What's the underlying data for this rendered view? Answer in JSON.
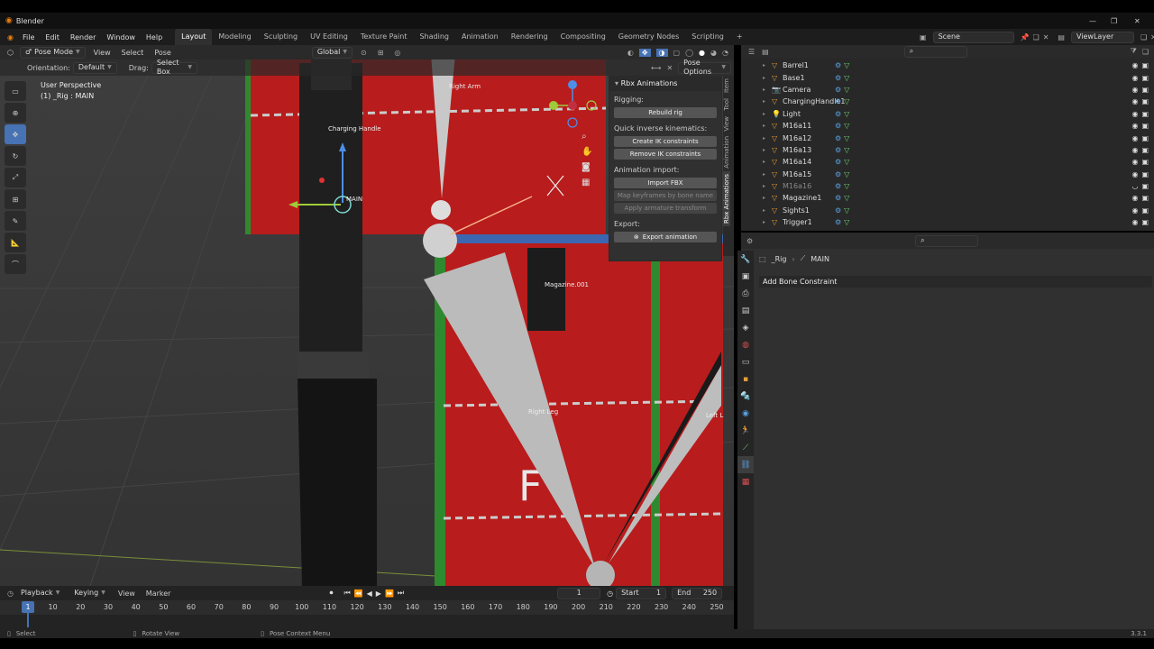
{
  "app": {
    "title": "Blender",
    "version": "3.3.1"
  },
  "menu": [
    "File",
    "Edit",
    "Render",
    "Window",
    "Help"
  ],
  "workspaces": [
    {
      "label": "Layout",
      "active": true
    },
    {
      "label": "Modeling"
    },
    {
      "label": "Sculpting"
    },
    {
      "label": "UV Editing"
    },
    {
      "label": "Texture Paint"
    },
    {
      "label": "Shading"
    },
    {
      "label": "Animation"
    },
    {
      "label": "Rendering"
    },
    {
      "label": "Compositing"
    },
    {
      "label": "Geometry Nodes"
    },
    {
      "label": "Scripting"
    }
  ],
  "add_tab": "+",
  "scene": {
    "label": "Scene",
    "view_layer": "ViewLayer"
  },
  "viewport_header": {
    "mode": "Pose Mode",
    "menus": [
      "View",
      "Select",
      "Pose"
    ],
    "transform_orientation": "Global",
    "orientation_label": "Orientation:",
    "orientation_value": "Default",
    "drag_label": "Drag:",
    "drag_value": "Select Box",
    "pose_options": "Pose Options"
  },
  "viewport": {
    "perspective": "User Perspective",
    "selection": "(1) _Rig : MAIN",
    "labels": {
      "right_arm": "Right Arm",
      "charging_handle": "Charging Handle",
      "main": "MAIN",
      "magazine": "Magazine.001",
      "right_leg": "Right Leg",
      "left_leg": "Left L"
    }
  },
  "n_panel": {
    "title": "Rbx Animations",
    "rigging_label": "Rigging:",
    "rebuild": "Rebuild rig",
    "ik_label": "Quick inverse kinematics:",
    "create_ik": "Create IK constraints",
    "remove_ik": "Remove IK constraints",
    "import_label": "Animation import:",
    "import_fbx": "Import FBX",
    "map_keyframes": "Map keyframes by bone name",
    "apply_transform": "Apply armature transform",
    "export_label": "Export:",
    "export_anim": "Export animation",
    "tabs": [
      "Item",
      "Tool",
      "View",
      "Animation",
      "Rbx Animations"
    ]
  },
  "outliner": {
    "rows": [
      {
        "name": "Barrel1",
        "type": "mesh"
      },
      {
        "name": "Base1",
        "type": "mesh"
      },
      {
        "name": "Camera",
        "type": "camera"
      },
      {
        "name": "ChargingHandle1",
        "type": "mesh"
      },
      {
        "name": "Light",
        "type": "light"
      },
      {
        "name": "M16a11",
        "type": "mesh"
      },
      {
        "name": "M16a12",
        "type": "mesh"
      },
      {
        "name": "M16a13",
        "type": "mesh"
      },
      {
        "name": "M16a14",
        "type": "mesh"
      },
      {
        "name": "M16a15",
        "type": "mesh"
      },
      {
        "name": "M16a16",
        "type": "mesh",
        "hidden": true
      },
      {
        "name": "Magazine1",
        "type": "mesh"
      },
      {
        "name": "Sights1",
        "type": "mesh"
      },
      {
        "name": "Trigger1",
        "type": "mesh"
      }
    ]
  },
  "properties": {
    "breadcrumb_obj": "_Rig",
    "breadcrumb_bone": "MAIN",
    "add_constraint": "Add Bone Constraint"
  },
  "timeline": {
    "menus": [
      "Playback",
      "Keying",
      "View",
      "Marker"
    ],
    "current_frame": "1",
    "start_label": "Start",
    "start": "1",
    "end_label": "End",
    "end": "250",
    "ticks": [
      "1",
      "10",
      "20",
      "30",
      "40",
      "50",
      "60",
      "70",
      "80",
      "90",
      "100",
      "110",
      "120",
      "130",
      "140",
      "150",
      "160",
      "170",
      "180",
      "190",
      "200",
      "210",
      "220",
      "230",
      "240",
      "250"
    ]
  },
  "status": {
    "select": "Select",
    "rotate": "Rotate View",
    "context": "Pose Context Menu",
    "version": "3.3.1"
  },
  "colors": {
    "accent": "#4772b3",
    "mesh_icon": "#e69f3c",
    "red_block": "#b81c1c"
  }
}
